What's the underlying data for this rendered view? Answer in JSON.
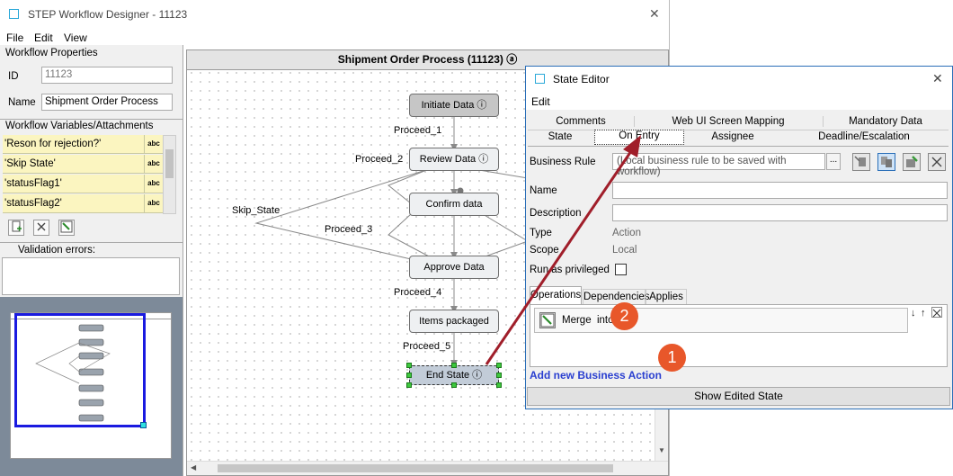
{
  "main_window": {
    "title": "STEP Workflow Designer - 11123",
    "close_glyph": "✕"
  },
  "menu": [
    "File",
    "Edit",
    "View"
  ],
  "workflow_properties": {
    "section_label": "Workflow Properties",
    "id_label": "ID",
    "id_value": "11123",
    "name_label": "Name",
    "name_value": "Shipment Order Process"
  },
  "variables": {
    "section_label": "Workflow Variables/Attachments",
    "rows": [
      "'Reson for rejection?'",
      "'Skip State'",
      "'statusFlag1'",
      "'statusFlag2'"
    ],
    "type_badge": "abc"
  },
  "validation": {
    "label": "Validation errors:"
  },
  "canvas": {
    "title": "Shipment Order Process (11123) ⓐ",
    "nodes": [
      {
        "label": "Initiate Data ⓘ"
      },
      {
        "label": "Review Data ⓘ"
      },
      {
        "label": "Confirm data"
      },
      {
        "label": "Approve Data"
      },
      {
        "label": "Items packaged"
      },
      {
        "label": "End State ⓘ"
      }
    ],
    "edges": [
      "Proceed_1",
      "Proceed_2",
      "Skip_State",
      "Proceed_3",
      "Proceed_4",
      "Proceed_5"
    ]
  },
  "state_editor": {
    "title": "State Editor",
    "close_glyph": "✕",
    "menu": "Edit",
    "tabs_row1": [
      "Comments",
      "Web UI Screen Mapping",
      "Mandatory Data"
    ],
    "tabs_row2": [
      "State",
      "On Entry",
      "Assignee",
      "Deadline/Escalation"
    ],
    "business_rule_label": "Business Rule",
    "business_rule_placeholder": "(Local business rule to be saved with workflow)",
    "browse_label": "...",
    "name_label": "Name",
    "description_label": "Description",
    "type_label": "Type",
    "type_value": "Action",
    "scope_label": "Scope",
    "scope_value": "Local",
    "privileged_label": "Run as privileged",
    "subtabs": [
      "Operations",
      "Dependencies",
      "Applies if"
    ],
    "operation_item": "Merge  into",
    "add_link": "Add new Business Action",
    "show_button": "Show Edited State"
  },
  "callouts": [
    "2",
    "1"
  ],
  "colors": {
    "accent_blue": "#2b6fb8",
    "callout": "#e8572a",
    "arrow": "#a01e2a",
    "variable_bg": "#fbf5c0"
  }
}
